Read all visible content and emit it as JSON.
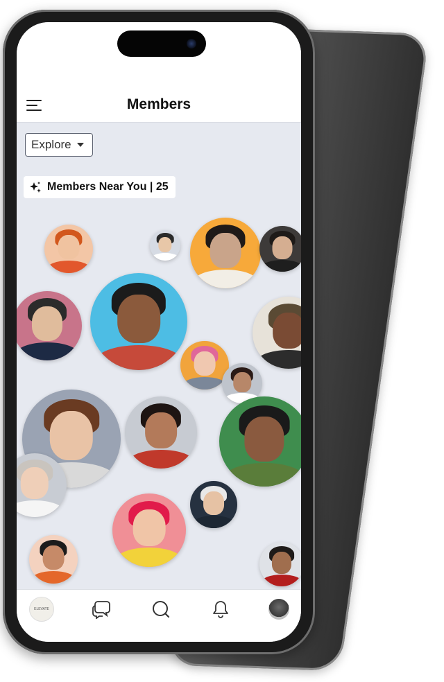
{
  "header": {
    "title": "Members",
    "menu_icon": "hamburger-menu-icon"
  },
  "filter": {
    "selected": "Explore",
    "icon": "chevron-down-icon"
  },
  "near_badge": {
    "label": "Members Near You | 25",
    "icon": "sparkle-icon"
  },
  "members": [
    {
      "id": "m1",
      "bg": "#f3c6a6",
      "hair": "#d2571c",
      "skin": "#f0c3a0",
      "shirt": "#e2572c"
    },
    {
      "id": "m2",
      "bg": "#d6dbe4",
      "hair": "#2a2a2a",
      "skin": "#e8c7a8",
      "shirt": "#ffffff"
    },
    {
      "id": "m3",
      "bg": "#f7a93a",
      "hair": "#1f1a18",
      "skin": "#c9a48a",
      "shirt": "#f2eee6"
    },
    {
      "id": "m4",
      "bg": "#3d3a39",
      "hair": "#1e1a18",
      "skin": "#d5ae91",
      "shirt": "#1e1e1e"
    },
    {
      "id": "m5",
      "bg": "#c8748a",
      "hair": "#2b2b2b",
      "skin": "#e0bc9c",
      "shirt": "#1d2a44"
    },
    {
      "id": "m6",
      "bg": "#4dbde4",
      "hair": "#1b1b1b",
      "skin": "#8b5a3c",
      "shirt": "#c64a3a"
    },
    {
      "id": "m7",
      "bg": "#e7e2d9",
      "hair": "#5a4a34",
      "skin": "#7a4b34",
      "shirt": "#2c2c2c"
    },
    {
      "id": "m8",
      "bg": "#f1a43c",
      "hair": "#e0679a",
      "skin": "#f0c8b0",
      "shirt": "#7b8799"
    },
    {
      "id": "m9",
      "bg": "#bfc4cc",
      "hair": "#2a1a16",
      "skin": "#b78769",
      "shirt": "#ffffff"
    },
    {
      "id": "m10",
      "bg": "#9aa3b3",
      "hair": "#6a3b22",
      "skin": "#e9c3a6",
      "shirt": "#d9d9d9"
    },
    {
      "id": "m11",
      "bg": "#c7cbd2",
      "hair": "#1d1412",
      "skin": "#b37a5a",
      "shirt": "#c0392b"
    },
    {
      "id": "m12",
      "bg": "#3f8d4e",
      "hair": "#1a1a1a",
      "skin": "#8a5a3f",
      "shirt": "#5a7d3a"
    },
    {
      "id": "m13",
      "bg": "#c8ccd3",
      "hair": "#c9c4be",
      "skin": "#efcfb8",
      "shirt": "#f5f5f5"
    },
    {
      "id": "m14",
      "bg": "#263140",
      "hair": "#e8e8e8",
      "skin": "#e6c2a4",
      "shirt": "#1d2733"
    },
    {
      "id": "m15",
      "bg": "#f08f96",
      "hair": "#e11b4a",
      "skin": "#f0c5a7",
      "shirt": "#f2d23a"
    },
    {
      "id": "m16",
      "bg": "#f4d2bf",
      "hair": "#1b1b1b",
      "skin": "#c68a68",
      "shirt": "#e4672a"
    },
    {
      "id": "m17",
      "bg": "#dfe2e7",
      "hair": "#1e1a18",
      "skin": "#a06e4e",
      "shirt": "#b31e1e"
    }
  ],
  "bottom_nav": {
    "brand_text": "ELEVATE",
    "items": [
      "home-logo-icon",
      "chat-bubbles-icon",
      "search-icon",
      "bell-icon",
      "profile-avatar-icon"
    ]
  }
}
